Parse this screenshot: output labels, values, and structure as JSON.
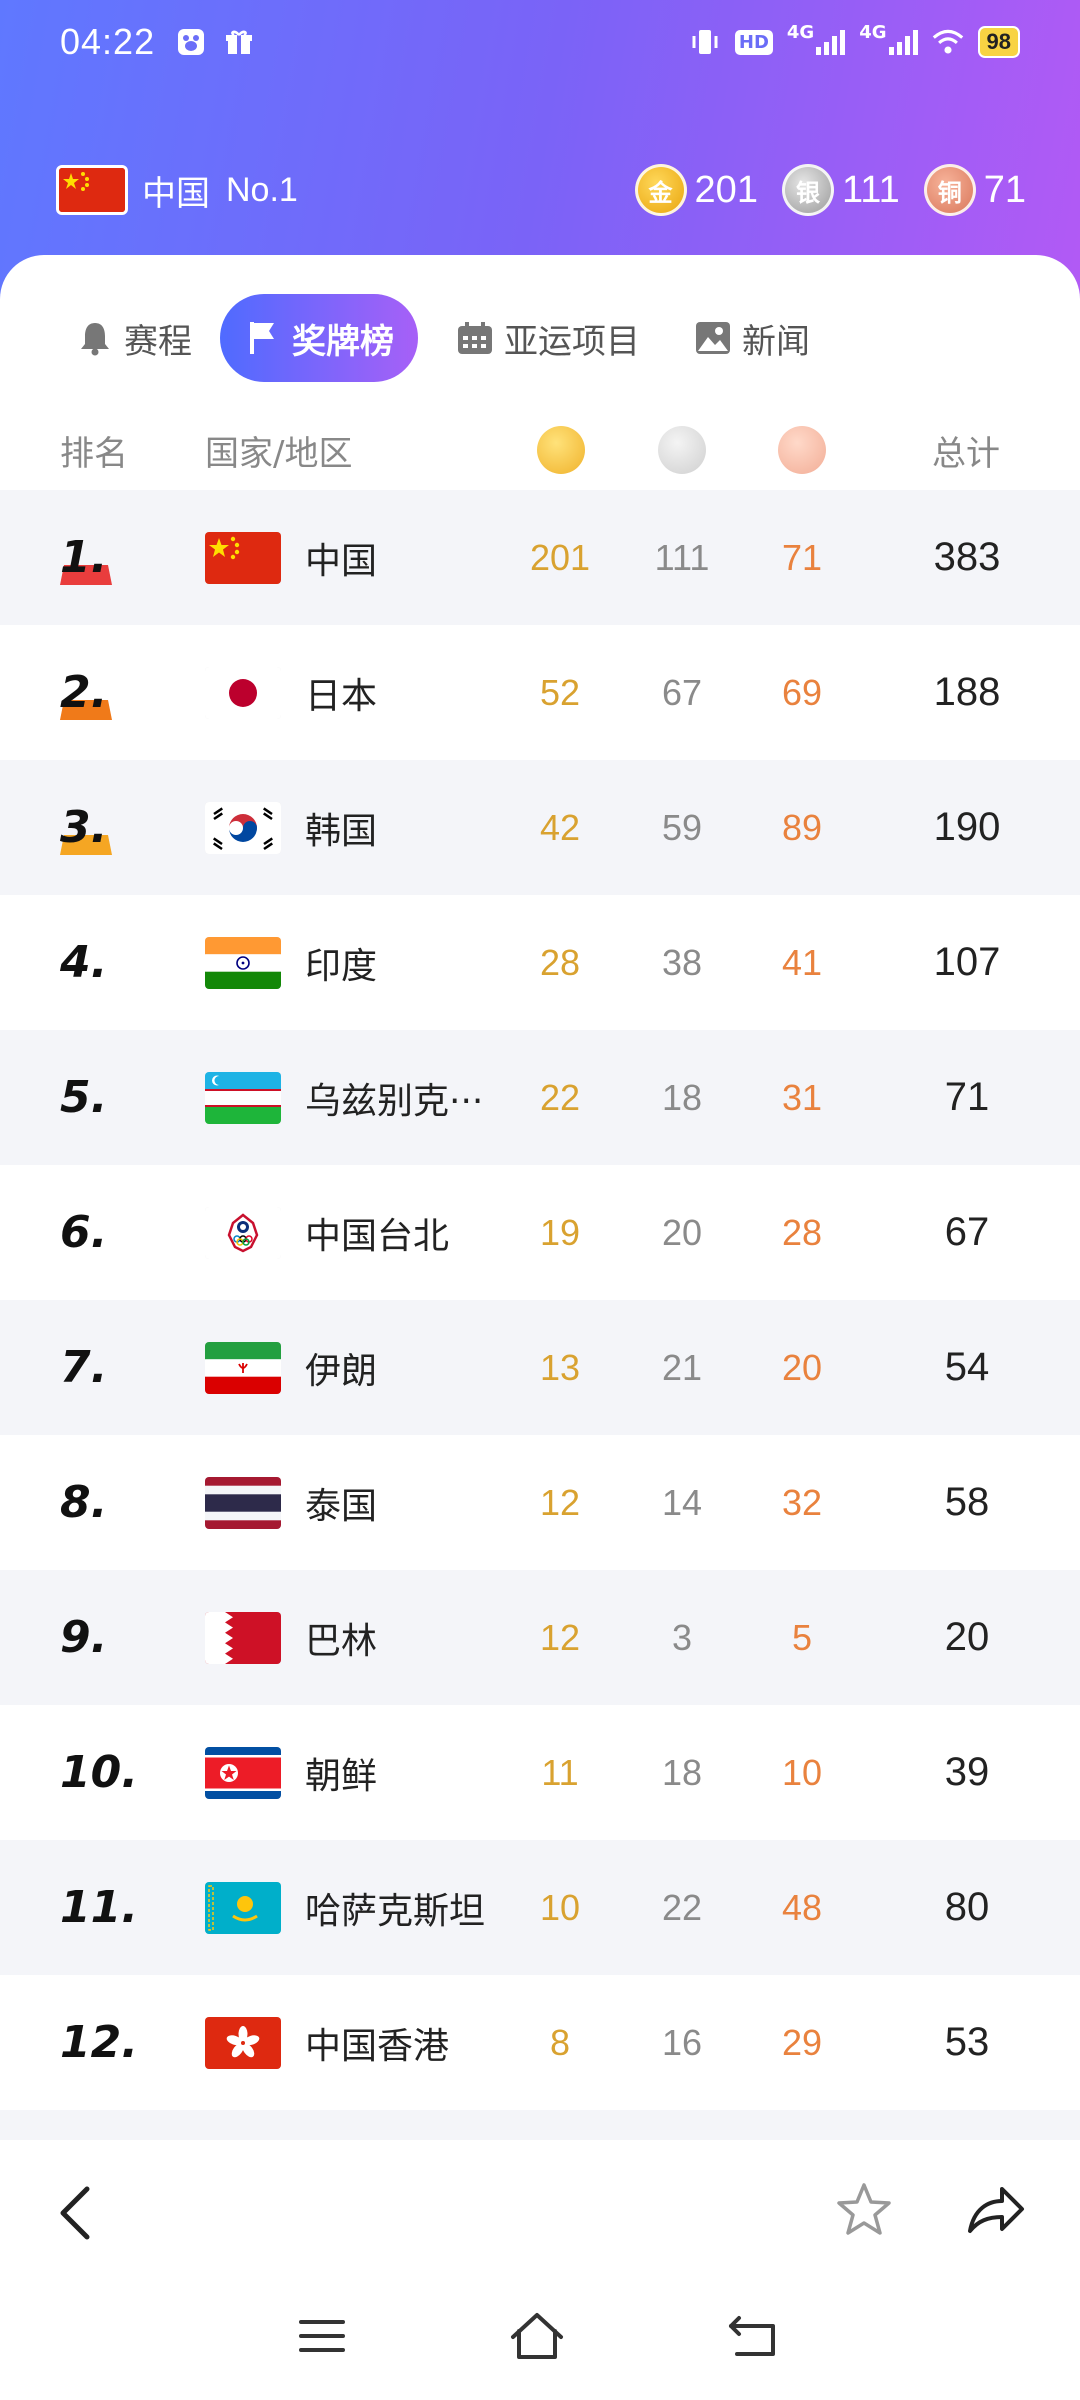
{
  "status": {
    "time": "04:22",
    "hd_label": "HD",
    "net1": "4G",
    "net2": "4G",
    "battery": "98"
  },
  "summary": {
    "country": "中国",
    "rank": "No.1",
    "gold_label": "金",
    "silver_label": "银",
    "bronze_label": "铜",
    "gold": "201",
    "silver": "111",
    "bronze": "71"
  },
  "tabs": [
    {
      "label": "赛程",
      "icon": "bell-icon"
    },
    {
      "label": "奖牌榜",
      "icon": "flag-icon"
    },
    {
      "label": "亚运项目",
      "icon": "calendar-icon"
    },
    {
      "label": "新闻",
      "icon": "image-icon"
    }
  ],
  "table": {
    "headers": {
      "rank": "排名",
      "country": "国家/地区",
      "total": "总计"
    },
    "rows": [
      {
        "rank": "1.",
        "country": "中国",
        "gold": "201",
        "silver": "111",
        "bronze": "71",
        "total": "383",
        "flag": "china"
      },
      {
        "rank": "2.",
        "country": "日本",
        "gold": "52",
        "silver": "67",
        "bronze": "69",
        "total": "188",
        "flag": "japan"
      },
      {
        "rank": "3.",
        "country": "韩国",
        "gold": "42",
        "silver": "59",
        "bronze": "89",
        "total": "190",
        "flag": "korea"
      },
      {
        "rank": "4.",
        "country": "印度",
        "gold": "28",
        "silver": "38",
        "bronze": "41",
        "total": "107",
        "flag": "india"
      },
      {
        "rank": "5.",
        "country": "乌兹别克···",
        "gold": "22",
        "silver": "18",
        "bronze": "31",
        "total": "71",
        "flag": "uzbekistan"
      },
      {
        "rank": "6.",
        "country": "中国台北",
        "gold": "19",
        "silver": "20",
        "bronze": "28",
        "total": "67",
        "flag": "chinese-taipei"
      },
      {
        "rank": "7.",
        "country": "伊朗",
        "gold": "13",
        "silver": "21",
        "bronze": "20",
        "total": "54",
        "flag": "iran"
      },
      {
        "rank": "8.",
        "country": "泰国",
        "gold": "12",
        "silver": "14",
        "bronze": "32",
        "total": "58",
        "flag": "thailand"
      },
      {
        "rank": "9.",
        "country": "巴林",
        "gold": "12",
        "silver": "3",
        "bronze": "5",
        "total": "20",
        "flag": "bahrain"
      },
      {
        "rank": "10.",
        "country": "朝鲜",
        "gold": "11",
        "silver": "18",
        "bronze": "10",
        "total": "39",
        "flag": "dprk"
      },
      {
        "rank": "11.",
        "country": "哈萨克斯坦",
        "gold": "10",
        "silver": "22",
        "bronze": "48",
        "total": "80",
        "flag": "kazakhstan"
      },
      {
        "rank": "12.",
        "country": "中国香港",
        "gold": "8",
        "silver": "16",
        "bronze": "29",
        "total": "53",
        "flag": "hong-kong"
      }
    ]
  },
  "colors": {
    "gold": "#d9a230",
    "silver": "#8a8a8a",
    "bronze": "#e9823e",
    "accent_start": "#4f6bff",
    "accent_end": "#a760f7"
  },
  "toolbar": {
    "icons": [
      "back-icon",
      "star-icon",
      "share-icon"
    ]
  },
  "navbar": {
    "icons": [
      "menu-icon",
      "home-icon",
      "return-icon"
    ]
  }
}
